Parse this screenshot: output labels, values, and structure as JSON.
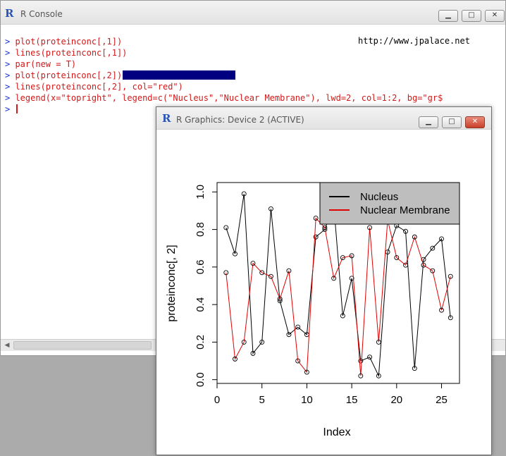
{
  "console": {
    "title": "R Console",
    "url_text": "http://www.jpalace.net",
    "lines": [
      {
        "prompt": ">",
        "text": "plot(proteinconc[,1])",
        "highlight": false,
        "cursor": false
      },
      {
        "prompt": ">",
        "text": "lines(proteinconc[,1])",
        "highlight": false,
        "cursor": false
      },
      {
        "prompt": ">",
        "text": "par(new = T)",
        "highlight": false,
        "cursor": false
      },
      {
        "prompt": ">",
        "text": "plot(proteinconc[,2])",
        "highlight": true,
        "cursor": false
      },
      {
        "prompt": ">",
        "text": "lines(proteinconc[,2], col=\"red\")",
        "highlight": false,
        "cursor": false
      },
      {
        "prompt": ">",
        "text": "legend(x=\"topright\", legend=c(\"Nucleus\",\"Nuclear Membrane\"), lwd=2, col=1:2, bg=\"gr$",
        "highlight": false,
        "cursor": false
      },
      {
        "prompt": ">",
        "text": "",
        "highlight": false,
        "cursor": true
      }
    ],
    "buttons": {
      "minimize": "▁",
      "maximize": "□",
      "close": "✕"
    }
  },
  "graphics": {
    "title": "R Graphics: Device 2 (ACTIVE)",
    "buttons": {
      "minimize": "▁",
      "maximize": "□",
      "close": "✕"
    }
  },
  "chart_data": {
    "type": "line",
    "xlabel": "Index",
    "ylabel": "proteinconc[, 2]",
    "xlim": [
      0,
      27
    ],
    "ylim": [
      -0.02,
      1.05
    ],
    "x_ticks": [
      "0",
      "5",
      "10",
      "15",
      "20",
      "25"
    ],
    "y_ticks": [
      "0.0",
      "0.2",
      "0.4",
      "0.6",
      "0.8",
      "1.0"
    ],
    "x": [
      1,
      2,
      3,
      4,
      5,
      6,
      7,
      8,
      9,
      10,
      11,
      12,
      13,
      14,
      15,
      16,
      17,
      18,
      19,
      20,
      21,
      22,
      23,
      24,
      25,
      26
    ],
    "series": [
      {
        "name": "Nucleus",
        "color": "#000000",
        "values": [
          0.81,
          0.67,
          0.99,
          0.14,
          0.2,
          0.91,
          0.42,
          0.24,
          0.28,
          0.24,
          0.76,
          0.8,
          0.93,
          0.34,
          0.54,
          0.1,
          0.12,
          0.02,
          0.68,
          0.82,
          0.79,
          0.06,
          0.64,
          0.7,
          0.75,
          0.33
        ]
      },
      {
        "name": "Nuclear Membrane",
        "color": "#e00000",
        "values": [
          0.57,
          0.11,
          0.2,
          0.62,
          0.57,
          0.55,
          0.43,
          0.58,
          0.1,
          0.04,
          0.86,
          0.81,
          0.54,
          0.65,
          0.66,
          0.02,
          0.81,
          0.2,
          0.85,
          0.65,
          0.61,
          0.76,
          0.61,
          0.58,
          0.37,
          0.55
        ]
      }
    ],
    "legend": {
      "position": "top-right",
      "background": "#bebebe"
    }
  }
}
